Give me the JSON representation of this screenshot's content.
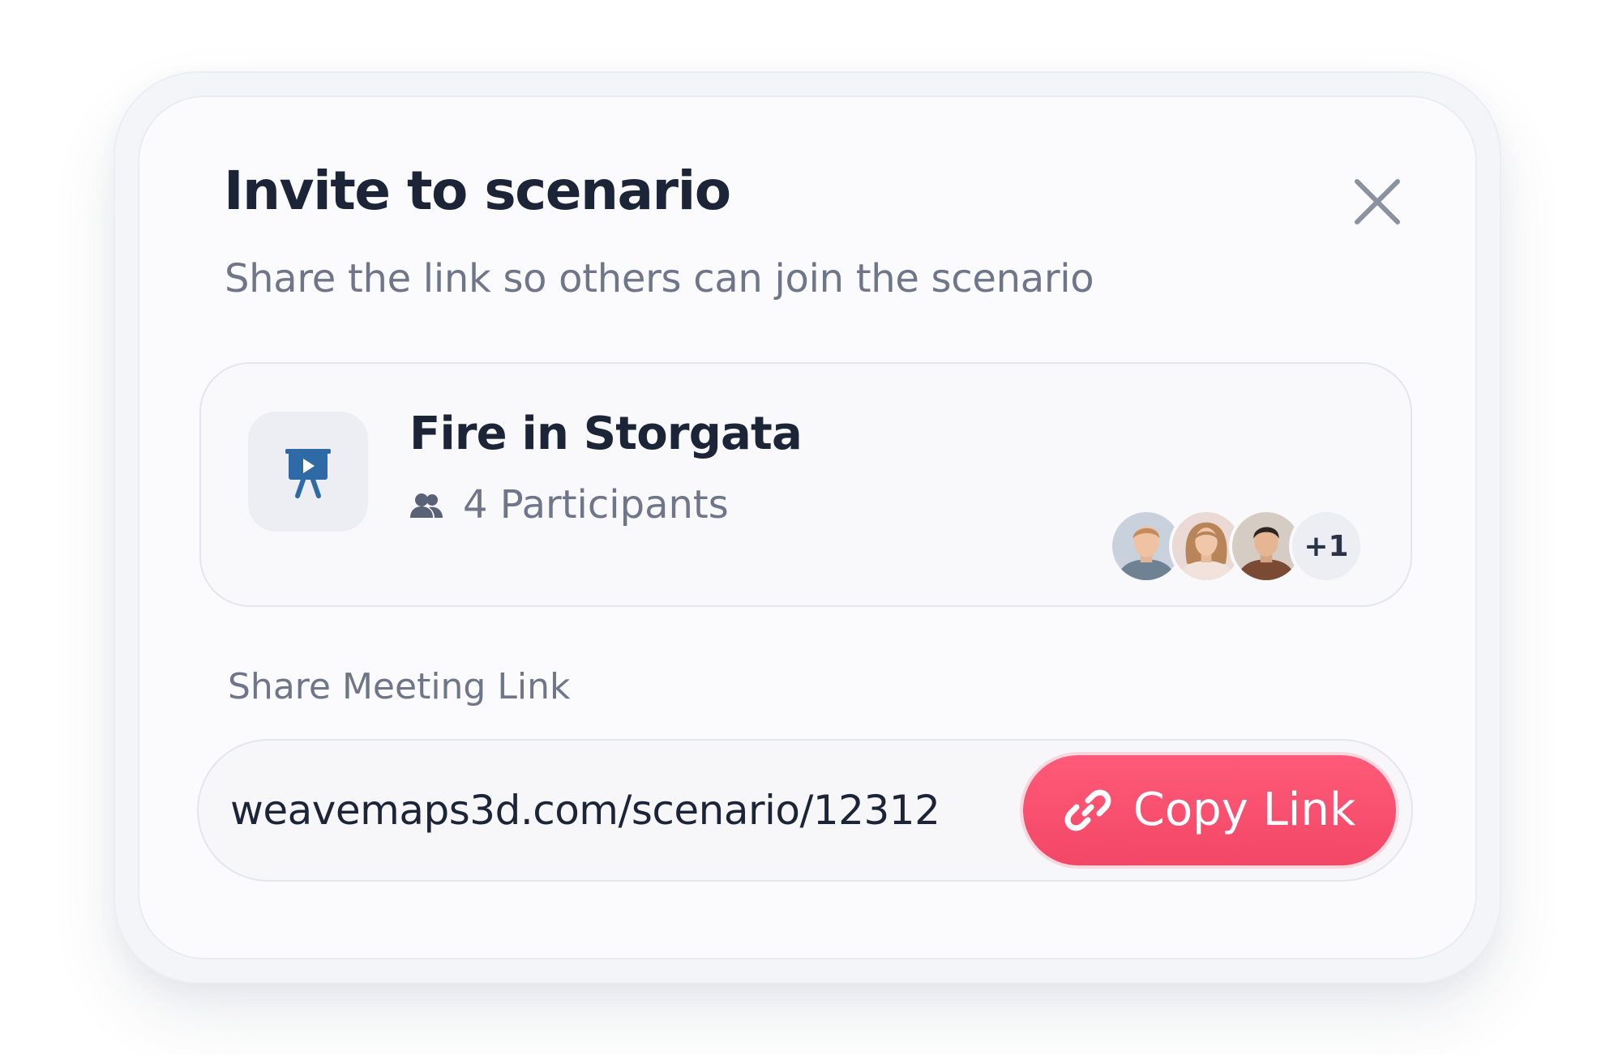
{
  "dialog": {
    "title": "Invite to scenario",
    "subtitle": "Share the link so others can join the scenario",
    "close_icon": "close-icon"
  },
  "scenario": {
    "name": "Fire in Storgata",
    "icon": "presentation-play-icon",
    "participants_icon": "users-icon",
    "participants_text": "4 Participants",
    "more_count": "+1",
    "avatars": [
      {
        "name": "avatar-1"
      },
      {
        "name": "avatar-2"
      },
      {
        "name": "avatar-3"
      }
    ]
  },
  "share": {
    "label": "Share Meeting Link",
    "url": "weavemaps3d.com/scenario/12312",
    "button_label": "Copy Link",
    "button_icon": "link-icon"
  },
  "colors": {
    "title": "#1c2437",
    "muted_text": "#6f7689",
    "accent": "#f34766",
    "icon_blue": "#2e6aa6",
    "card_background": "#fbfbfd"
  }
}
